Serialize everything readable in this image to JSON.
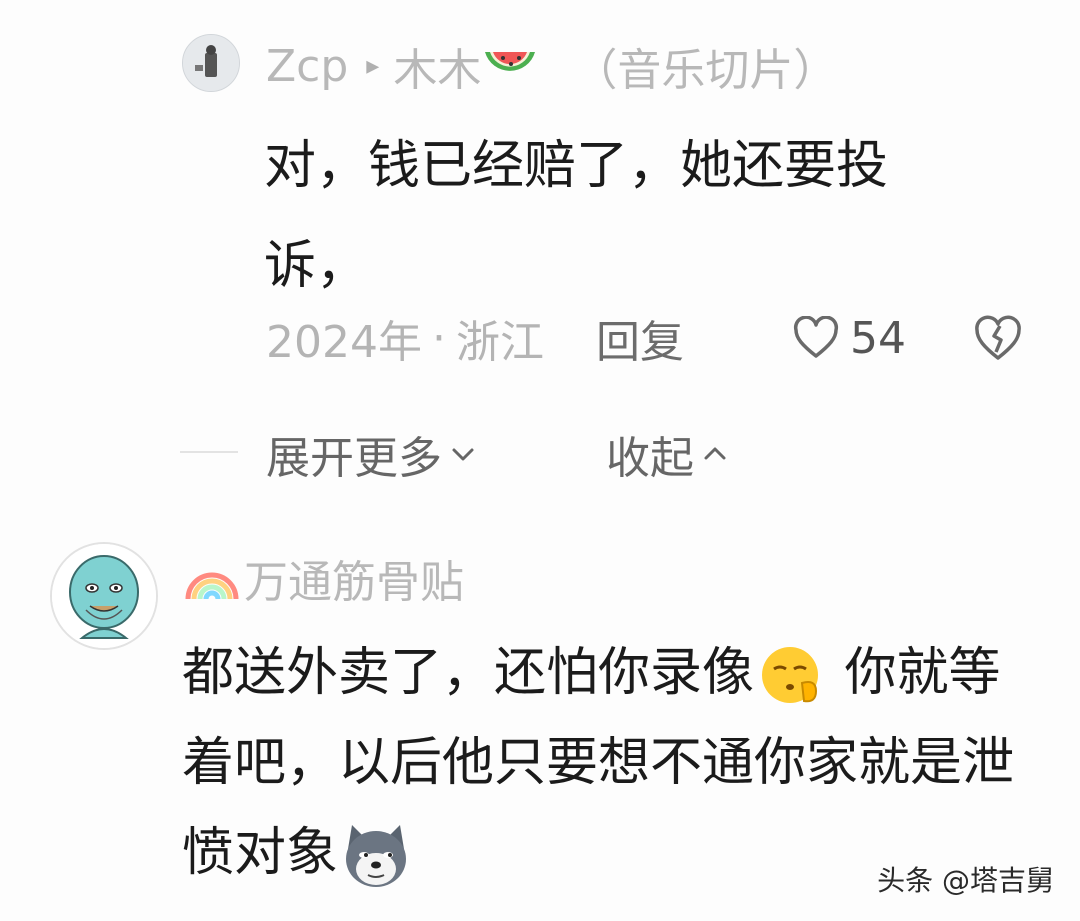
{
  "reply": {
    "user": "Zcp",
    "arrow": "▸",
    "target_user": "木木",
    "target_tag": "（音乐切片）",
    "text": "对，钱已经赔了，她还要投诉，",
    "time": "2024年",
    "separator": "·",
    "location": "浙江",
    "reply_label": "回复",
    "likes": "54"
  },
  "thread": {
    "expand_label": "展开更多",
    "collapse_label": "收起"
  },
  "comment": {
    "user": "万通筋骨贴",
    "text_part1": "都送外卖了，还怕你录像",
    "text_part2": " 你就等着吧，以后他只要想不通你家就是泄愤对象"
  },
  "watermark": "头条 @塔吉舅",
  "icons": {
    "heart": "heart-icon",
    "dislike": "broken-heart-icon",
    "expand": "chevron-down-icon",
    "collapse": "chevron-up-icon",
    "watermelon": "watermelon-icon",
    "rainbow": "rainbow-icon",
    "shush": "shush-emoji-icon",
    "dog": "dog-emoji-icon"
  }
}
